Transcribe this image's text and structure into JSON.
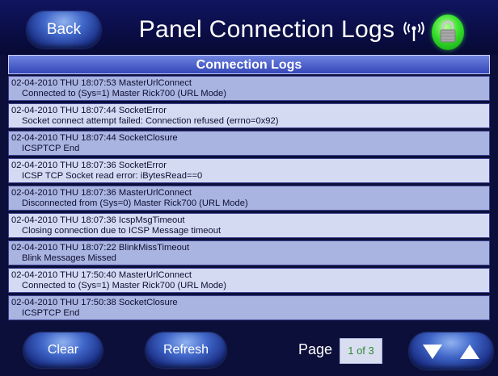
{
  "header": {
    "back_label": "Back",
    "title": "Panel Connection Logs",
    "icons": [
      "wireless-signal-icon",
      "lock-icon"
    ],
    "lock_color": "#2fd92a"
  },
  "panel": {
    "heading": "Connection Logs",
    "rows": [
      {
        "line1": "02-04-2010 THU 18:07:53 MasterUrlConnect",
        "line2": "Connected to (Sys=1) Master Rick700 (URL Mode)"
      },
      {
        "line1": "02-04-2010 THU 18:07:44 SocketError",
        "line2": "Socket connect attempt failed: Connection refused (errno=0x92)"
      },
      {
        "line1": "02-04-2010 THU 18:07:44 SocketClosure",
        "line2": "ICSPTCP End"
      },
      {
        "line1": "02-04-2010 THU 18:07:36 SocketError",
        "line2": "ICSP TCP Socket read error: iBytesRead==0"
      },
      {
        "line1": "02-04-2010 THU 18:07:36 MasterUrlConnect",
        "line2": "Disconnected from (Sys=0) Master Rick700 (URL Mode)"
      },
      {
        "line1": "02-04-2010 THU 18:07:36 IcspMsgTimeout",
        "line2": "Closing connection due to ICSP Message timeout"
      },
      {
        "line1": "02-04-2010 THU 18:07:22 BlinkMissTimeout",
        "line2": "Blink Messages Missed"
      },
      {
        "line1": "02-04-2010 THU 17:50:40 MasterUrlConnect",
        "line2": "Connected to (Sys=1) Master Rick700 (URL Mode)"
      },
      {
        "line1": "02-04-2010 THU 17:50:38 SocketClosure",
        "line2": "ICSPTCP End"
      }
    ]
  },
  "footer": {
    "clear_label": "Clear",
    "refresh_label": "Refresh",
    "page_label": "Page",
    "page_value": "1 of 3",
    "nav_icons": [
      "arrow-down-icon",
      "arrow-up-icon"
    ]
  },
  "colors": {
    "background": "#0b0f3a",
    "row_odd": "#aab4e0",
    "row_even": "#d4daf2",
    "heading_bar": "#4b5fcc",
    "page_value_text": "#2f8a2f"
  }
}
